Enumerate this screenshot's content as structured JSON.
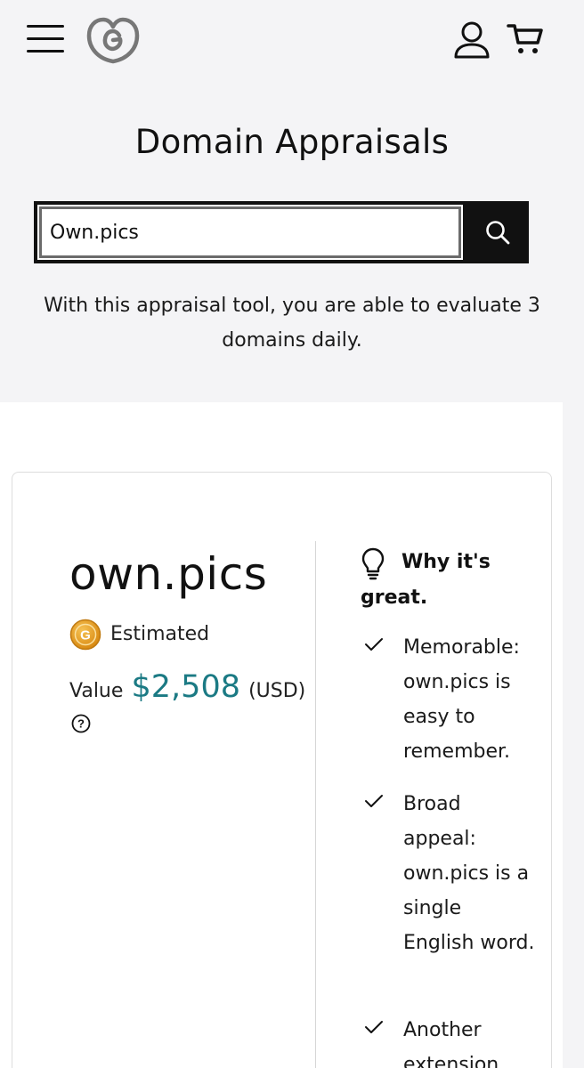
{
  "header": {
    "menu_icon": "hamburger-menu-icon",
    "logo_icon": "godaddy-logo-icon",
    "account_icon": "user-account-icon",
    "cart_icon": "shopping-cart-icon"
  },
  "page": {
    "title": "Domain Appraisals",
    "search": {
      "value": "Own.pics",
      "button_icon": "search-icon"
    },
    "intro": "With this appraisal tool, you are able to evaluate 3 domains daily."
  },
  "result": {
    "domain": "own.pics",
    "estimated_label": "Estimated",
    "value_label": "Value",
    "value_amount": "$2,508",
    "value_currency": "(USD)",
    "help_icon": "question-circle-icon",
    "accent_color": "#1b7a84"
  },
  "why": {
    "heading": "Why it's great.",
    "icon": "lightbulb-icon",
    "reasons": [
      {
        "text": "Memorable: own.pics is easy to remember."
      },
      {
        "text": "Broad appeal: own.pics is a single English word."
      },
      {
        "text": "Another extension"
      }
    ]
  }
}
